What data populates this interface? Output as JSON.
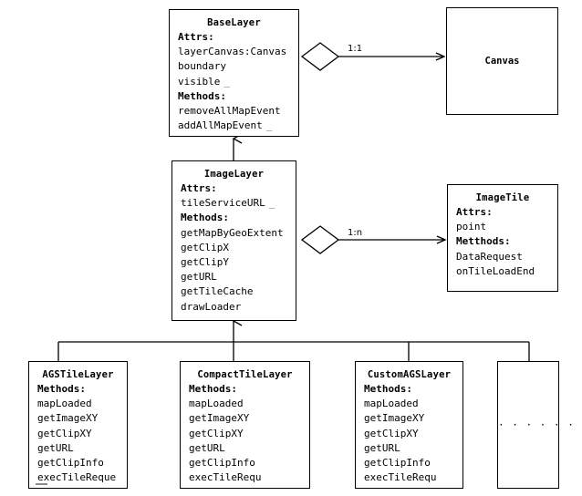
{
  "diagram": {
    "type": "uml-class-diagram",
    "background_color": "#ffffff",
    "line_color": "#000000"
  },
  "classes": {
    "base_layer": {
      "name": "BaseLayer",
      "attrs_label": "Attrs:",
      "attributes": [
        {
          "text": "layerCanvas:Canvas",
          "tail": ""
        },
        {
          "text": "boundary",
          "tail": ""
        },
        {
          "text": "visible",
          "tail": "_"
        }
      ],
      "methods_label": "Methods:",
      "methods": [
        {
          "text": "removeAllMapEvent",
          "tail": ""
        },
        {
          "text": "addAllMapEvent",
          "tail": "_"
        }
      ]
    },
    "image_layer": {
      "name": "ImageLayer",
      "attrs_label": "Attrs:",
      "attributes": [
        {
          "text": "tileServiceURL",
          "tail": "_"
        }
      ],
      "methods_label": "Methods:",
      "methods": [
        {
          "text": "getMapByGeoExtent",
          "tail": ""
        },
        {
          "text": "getClipX",
          "tail": ""
        },
        {
          "text": "getClipY",
          "tail": ""
        },
        {
          "text": "getURL",
          "tail": ""
        },
        {
          "text": "getTileCache",
          "tail": ""
        },
        {
          "text": "drawLoader",
          "tail": ""
        }
      ]
    },
    "canvas": {
      "name": "Canvas"
    },
    "image_tile": {
      "name": "ImageTile",
      "attrs_label": "Attrs:",
      "attributes": [
        {
          "text": "point",
          "tail": ""
        }
      ],
      "methods_label": "Metthods:",
      "methods": [
        {
          "text": "DataRequest",
          "tail": ""
        },
        {
          "text": "onTileLoadEnd",
          "tail": ""
        }
      ]
    },
    "ags_tile_layer": {
      "name": "AGSTileLayer",
      "methods_label": "Methods:",
      "methods": [
        {
          "text": "mapLoaded",
          "tail": ""
        },
        {
          "text": "getImageXY",
          "tail": ""
        },
        {
          "text": "getClipXY",
          "tail": ""
        },
        {
          "text": "getURL",
          "tail": ""
        },
        {
          "text": "getClipInfo",
          "tail": ""
        },
        {
          "text": "execTileReque",
          "tail": ""
        }
      ]
    },
    "compact_tile_layer": {
      "name": "CompactTileLayer",
      "methods_label": "Methods:",
      "methods": [
        {
          "text": "mapLoaded",
          "tail": ""
        },
        {
          "text": "getImageXY",
          "tail": ""
        },
        {
          "text": "getClipXY",
          "tail": ""
        },
        {
          "text": "getURL",
          "tail": ""
        },
        {
          "text": "getClipInfo",
          "tail": ""
        },
        {
          "text": "execTileRequ",
          "tail": ""
        }
      ]
    },
    "custom_ags_layer": {
      "name": "CustomAGSLayer",
      "methods_label": "Methods:",
      "methods": [
        {
          "text": "mapLoaded",
          "tail": ""
        },
        {
          "text": "getImageXY",
          "tail": ""
        },
        {
          "text": "getClipXY",
          "tail": ""
        },
        {
          "text": "getURL",
          "tail": ""
        },
        {
          "text": "getClipInfo",
          "tail": ""
        },
        {
          "text": "execTileRequ",
          "tail": ""
        }
      ]
    },
    "more_layers": {
      "name": "",
      "placeholder_dots": "· · · · · ·"
    }
  },
  "relations": {
    "base_to_canvas": {
      "multiplicity": "1:1",
      "kind": "aggregation-arrow"
    },
    "image_to_tile": {
      "multiplicity": "1:n",
      "kind": "aggregation-arrow"
    },
    "image_extends_base": {
      "kind": "generalization"
    },
    "subclasses_extend_image": {
      "kind": "generalization-tree"
    }
  }
}
